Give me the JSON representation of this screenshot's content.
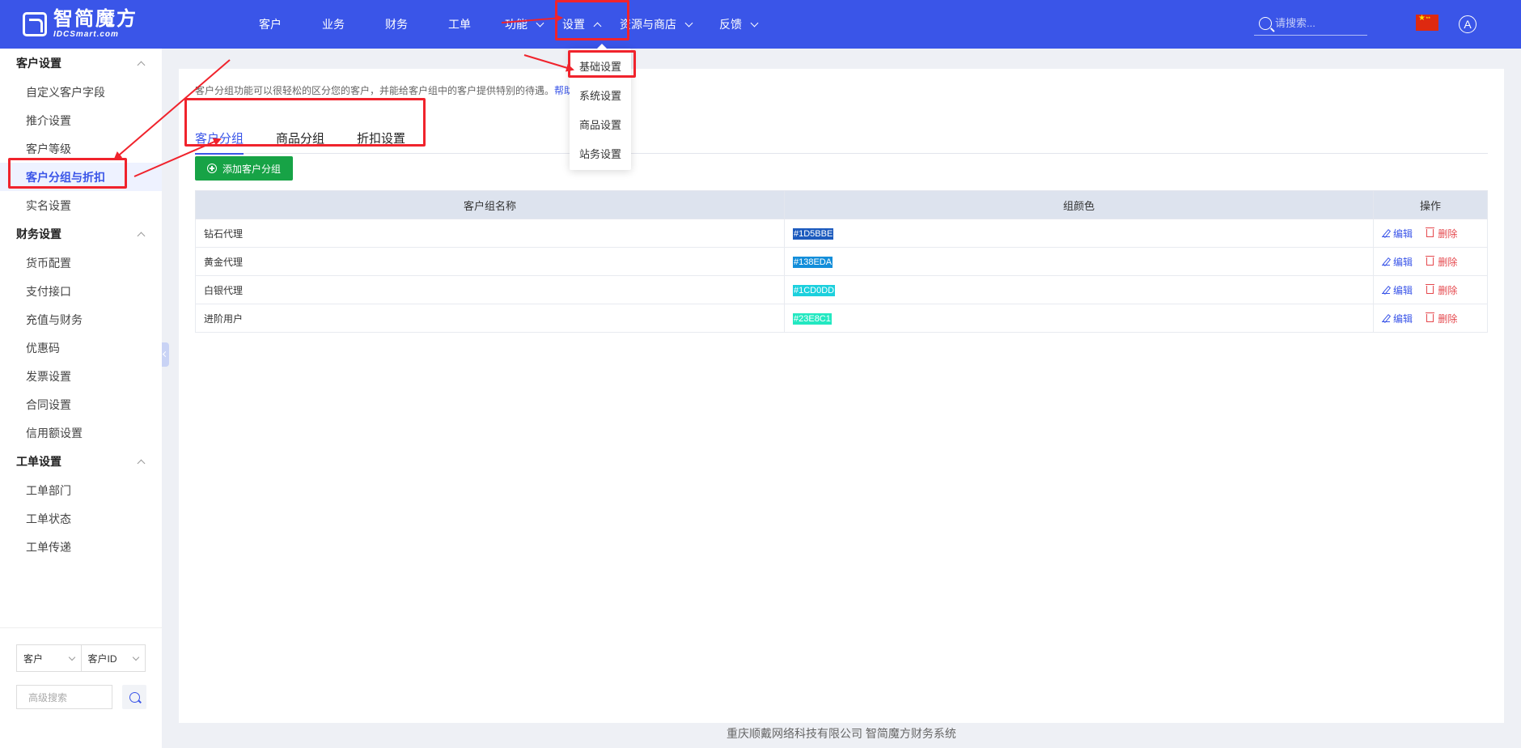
{
  "brand": {
    "name_cn": "智简魔方",
    "name_en": "IDCSmart.com"
  },
  "nav": {
    "items": [
      {
        "label": "客户",
        "has_menu": false
      },
      {
        "label": "业务",
        "has_menu": false
      },
      {
        "label": "财务",
        "has_menu": false
      },
      {
        "label": "工单",
        "has_menu": false
      },
      {
        "label": "功能",
        "has_menu": true
      },
      {
        "label": "设置",
        "has_menu": true,
        "open": true
      },
      {
        "label": "资源与商店",
        "has_menu": true
      },
      {
        "label": "反馈",
        "has_menu": true
      }
    ],
    "settings_menu": [
      "基础设置",
      "系统设置",
      "商品设置",
      "站务设置"
    ]
  },
  "search": {
    "placeholder": "请搜索..."
  },
  "avatar_letter": "A",
  "sidebar": {
    "groups": [
      {
        "title": "客户设置",
        "items": [
          "自定义客户字段",
          "推介设置",
          "客户等级",
          "客户分组与折扣",
          "实名设置"
        ]
      },
      {
        "title": "财务设置",
        "items": [
          "货币配置",
          "支付接口",
          "充值与财务",
          "优惠码",
          "发票设置",
          "合同设置",
          "信用额设置"
        ]
      },
      {
        "title": "工单设置",
        "items": [
          "工单部门",
          "工单状态",
          "工单传递"
        ]
      }
    ],
    "active_item": "客户分组与折扣",
    "filter": {
      "type": "客户",
      "field": "客户ID",
      "adv_placeholder": "高级搜索"
    }
  },
  "main": {
    "description": "客户分组功能可以很轻松的区分您的客户，并能给客户组中的客户提供特别的待遇。",
    "help_link": "帮助",
    "tabs": [
      "客户分组",
      "商品分组",
      "折扣设置"
    ],
    "active_tab": "客户分组",
    "add_button": "添加客户分组",
    "table": {
      "headers": [
        "客户组名称",
        "组颜色",
        "操作"
      ],
      "rows": [
        {
          "name": "钻石代理",
          "color": "#1D5BBE"
        },
        {
          "name": "黄金代理",
          "color": "#138EDA"
        },
        {
          "name": "白银代理",
          "color": "#1CD0DD"
        },
        {
          "name": "进阶用户",
          "color": "#23E8C1"
        }
      ],
      "edit_label": "编辑",
      "delete_label": "删除"
    }
  },
  "footer": "重庆顺戴网络科技有限公司 智简魔方财务系统",
  "colors": {
    "header": "#3a55e8",
    "accent": "#3a55e8",
    "add_button": "#17a346",
    "annotation": "#f0232c"
  }
}
